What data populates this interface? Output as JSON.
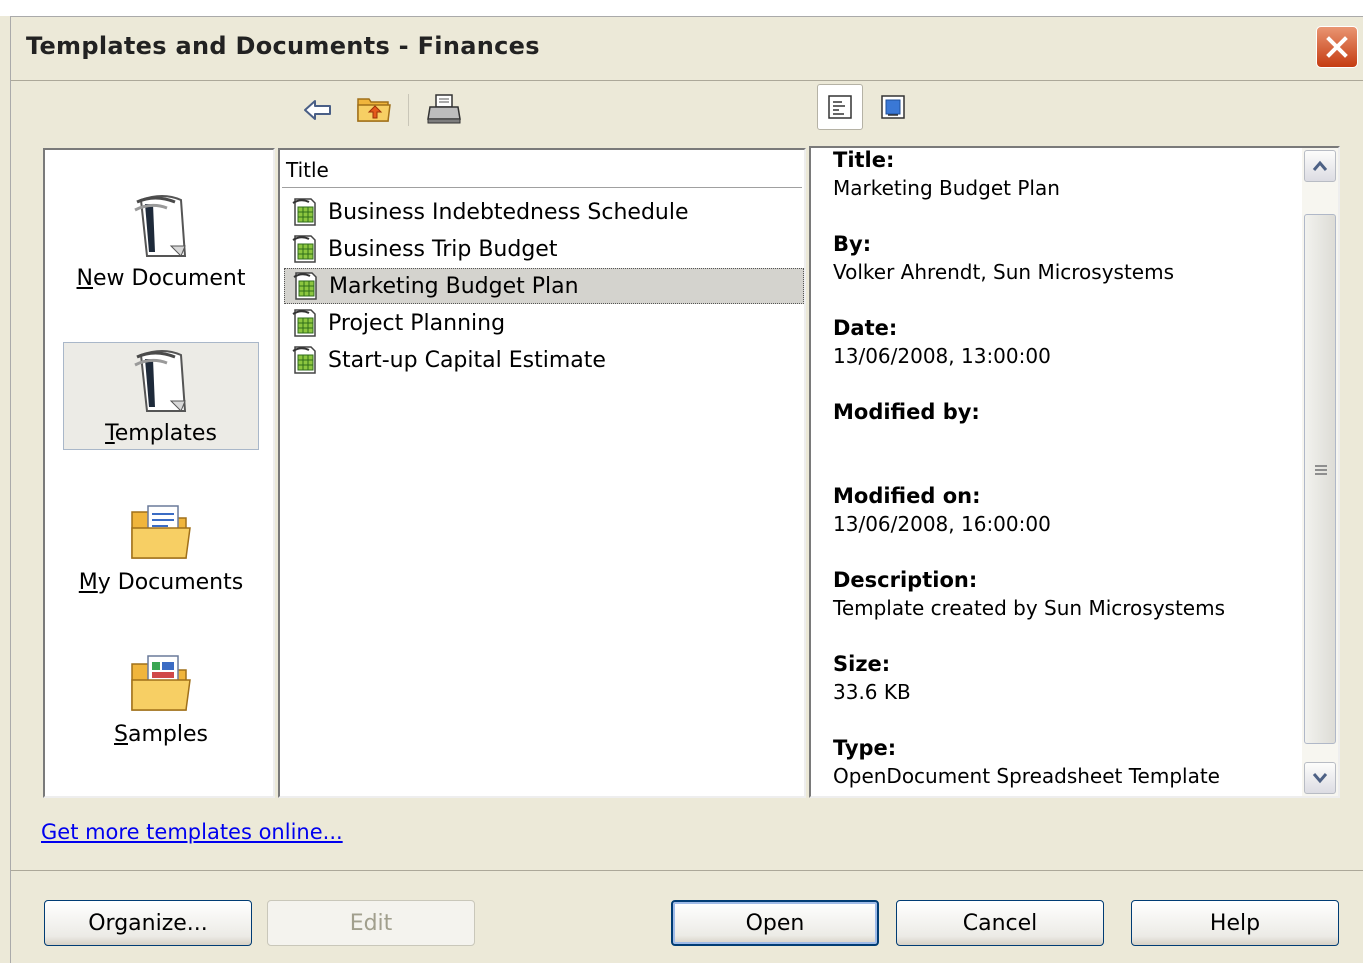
{
  "window": {
    "title": "Templates and Documents - Finances",
    "close_icon": "close-icon"
  },
  "toolbar": {
    "back_icon": "back-arrow-icon",
    "up_icon": "folder-up-icon",
    "print_icon": "printer-icon",
    "document_properties_icon": "document-properties-icon",
    "preview_icon": "preview-icon"
  },
  "categories": [
    {
      "label": "New Document",
      "icon": "new-document-icon"
    },
    {
      "label": "Templates",
      "icon": "templates-icon"
    },
    {
      "label": "My Documents",
      "icon": "my-documents-folder-icon"
    },
    {
      "label": "Samples",
      "icon": "samples-folder-icon"
    }
  ],
  "list": {
    "column_header": "Title",
    "items": [
      {
        "label": "Business Indebtedness Schedule",
        "icon": "spreadsheet-template-icon"
      },
      {
        "label": "Business Trip Budget",
        "icon": "spreadsheet-template-icon"
      },
      {
        "label": "Marketing Budget Plan",
        "icon": "spreadsheet-template-icon"
      },
      {
        "label": "Project Planning",
        "icon": "spreadsheet-template-icon"
      },
      {
        "label": "Start-up Capital Estimate",
        "icon": "spreadsheet-template-icon"
      }
    ]
  },
  "properties": {
    "title_label": "Title:",
    "title_value": "Marketing Budget Plan",
    "by_label": "By:",
    "by_value": "Volker Ahrendt, Sun Microsystems",
    "date_label": "Date:",
    "date_value": "13/06/2008, 13:00:00",
    "modified_by_label": "Modified by:",
    "modified_by_value": "",
    "modified_on_label": "Modified on:",
    "modified_on_value": "13/06/2008, 16:00:00",
    "description_label": "Description:",
    "description_value": "Template created by Sun Microsystems",
    "size_label": "Size:",
    "size_value": "33.6 KB",
    "type_label": "Type:",
    "type_value": "OpenDocument Spreadsheet Template"
  },
  "link": {
    "label": "Get more templates online..."
  },
  "buttons": {
    "organize": "Organize...",
    "edit": "Edit",
    "open": "Open",
    "cancel": "Cancel",
    "help": "Help"
  }
}
